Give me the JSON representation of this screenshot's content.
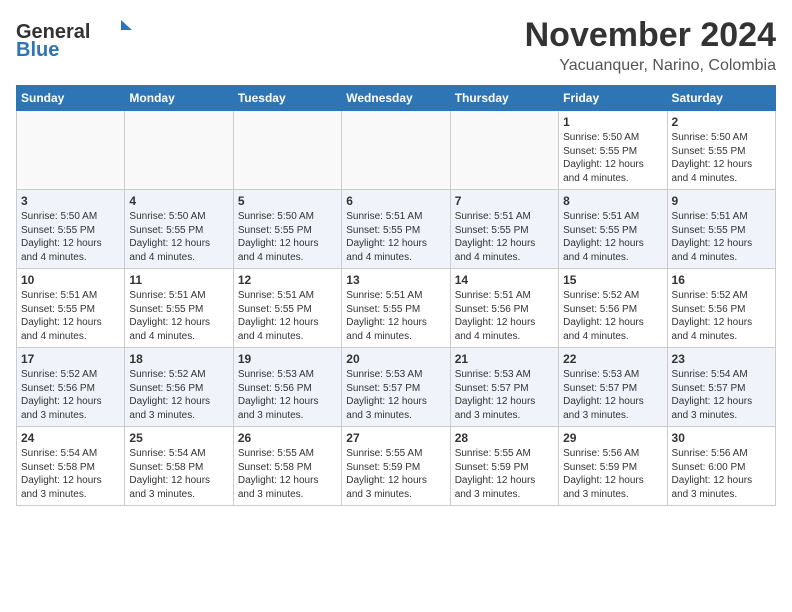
{
  "header": {
    "logo_general": "General",
    "logo_blue": "Blue",
    "month_title": "November 2024",
    "location": "Yacuanquer, Narino, Colombia"
  },
  "weekdays": [
    "Sunday",
    "Monday",
    "Tuesday",
    "Wednesday",
    "Thursday",
    "Friday",
    "Saturday"
  ],
  "weeks": [
    [
      {
        "day": "",
        "info": ""
      },
      {
        "day": "",
        "info": ""
      },
      {
        "day": "",
        "info": ""
      },
      {
        "day": "",
        "info": ""
      },
      {
        "day": "",
        "info": ""
      },
      {
        "day": "1",
        "info": "Sunrise: 5:50 AM\nSunset: 5:55 PM\nDaylight: 12 hours and 4 minutes."
      },
      {
        "day": "2",
        "info": "Sunrise: 5:50 AM\nSunset: 5:55 PM\nDaylight: 12 hours and 4 minutes."
      }
    ],
    [
      {
        "day": "3",
        "info": "Sunrise: 5:50 AM\nSunset: 5:55 PM\nDaylight: 12 hours and 4 minutes."
      },
      {
        "day": "4",
        "info": "Sunrise: 5:50 AM\nSunset: 5:55 PM\nDaylight: 12 hours and 4 minutes."
      },
      {
        "day": "5",
        "info": "Sunrise: 5:50 AM\nSunset: 5:55 PM\nDaylight: 12 hours and 4 minutes."
      },
      {
        "day": "6",
        "info": "Sunrise: 5:51 AM\nSunset: 5:55 PM\nDaylight: 12 hours and 4 minutes."
      },
      {
        "day": "7",
        "info": "Sunrise: 5:51 AM\nSunset: 5:55 PM\nDaylight: 12 hours and 4 minutes."
      },
      {
        "day": "8",
        "info": "Sunrise: 5:51 AM\nSunset: 5:55 PM\nDaylight: 12 hours and 4 minutes."
      },
      {
        "day": "9",
        "info": "Sunrise: 5:51 AM\nSunset: 5:55 PM\nDaylight: 12 hours and 4 minutes."
      }
    ],
    [
      {
        "day": "10",
        "info": "Sunrise: 5:51 AM\nSunset: 5:55 PM\nDaylight: 12 hours and 4 minutes."
      },
      {
        "day": "11",
        "info": "Sunrise: 5:51 AM\nSunset: 5:55 PM\nDaylight: 12 hours and 4 minutes."
      },
      {
        "day": "12",
        "info": "Sunrise: 5:51 AM\nSunset: 5:55 PM\nDaylight: 12 hours and 4 minutes."
      },
      {
        "day": "13",
        "info": "Sunrise: 5:51 AM\nSunset: 5:55 PM\nDaylight: 12 hours and 4 minutes."
      },
      {
        "day": "14",
        "info": "Sunrise: 5:51 AM\nSunset: 5:56 PM\nDaylight: 12 hours and 4 minutes."
      },
      {
        "day": "15",
        "info": "Sunrise: 5:52 AM\nSunset: 5:56 PM\nDaylight: 12 hours and 4 minutes."
      },
      {
        "day": "16",
        "info": "Sunrise: 5:52 AM\nSunset: 5:56 PM\nDaylight: 12 hours and 4 minutes."
      }
    ],
    [
      {
        "day": "17",
        "info": "Sunrise: 5:52 AM\nSunset: 5:56 PM\nDaylight: 12 hours and 3 minutes."
      },
      {
        "day": "18",
        "info": "Sunrise: 5:52 AM\nSunset: 5:56 PM\nDaylight: 12 hours and 3 minutes."
      },
      {
        "day": "19",
        "info": "Sunrise: 5:53 AM\nSunset: 5:56 PM\nDaylight: 12 hours and 3 minutes."
      },
      {
        "day": "20",
        "info": "Sunrise: 5:53 AM\nSunset: 5:57 PM\nDaylight: 12 hours and 3 minutes."
      },
      {
        "day": "21",
        "info": "Sunrise: 5:53 AM\nSunset: 5:57 PM\nDaylight: 12 hours and 3 minutes."
      },
      {
        "day": "22",
        "info": "Sunrise: 5:53 AM\nSunset: 5:57 PM\nDaylight: 12 hours and 3 minutes."
      },
      {
        "day": "23",
        "info": "Sunrise: 5:54 AM\nSunset: 5:57 PM\nDaylight: 12 hours and 3 minutes."
      }
    ],
    [
      {
        "day": "24",
        "info": "Sunrise: 5:54 AM\nSunset: 5:58 PM\nDaylight: 12 hours and 3 minutes."
      },
      {
        "day": "25",
        "info": "Sunrise: 5:54 AM\nSunset: 5:58 PM\nDaylight: 12 hours and 3 minutes."
      },
      {
        "day": "26",
        "info": "Sunrise: 5:55 AM\nSunset: 5:58 PM\nDaylight: 12 hours and 3 minutes."
      },
      {
        "day": "27",
        "info": "Sunrise: 5:55 AM\nSunset: 5:59 PM\nDaylight: 12 hours and 3 minutes."
      },
      {
        "day": "28",
        "info": "Sunrise: 5:55 AM\nSunset: 5:59 PM\nDaylight: 12 hours and 3 minutes."
      },
      {
        "day": "29",
        "info": "Sunrise: 5:56 AM\nSunset: 5:59 PM\nDaylight: 12 hours and 3 minutes."
      },
      {
        "day": "30",
        "info": "Sunrise: 5:56 AM\nSunset: 6:00 PM\nDaylight: 12 hours and 3 minutes."
      }
    ]
  ]
}
